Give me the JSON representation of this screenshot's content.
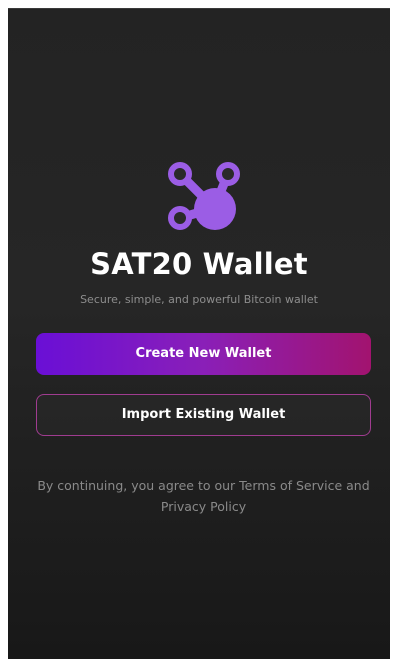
{
  "app": {
    "title": "SAT20 Wallet",
    "subtitle": "Secure, simple, and powerful Bitcoin wallet",
    "logo_icon": "sat20-logo-icon"
  },
  "actions": {
    "create_label": "Create New Wallet",
    "import_label": "Import Existing Wallet"
  },
  "legal": {
    "terms_text": "By continuing, you agree to our Terms of Service and Privacy Policy"
  },
  "colors": {
    "background": "#232323",
    "logo_purple": "#9b5de5",
    "create_gradient_start": "#6a0fd6",
    "create_gradient_end": "#a2136f",
    "import_border": "#a03c90",
    "title": "#ffffff",
    "muted_text": "#8a8a8a"
  }
}
